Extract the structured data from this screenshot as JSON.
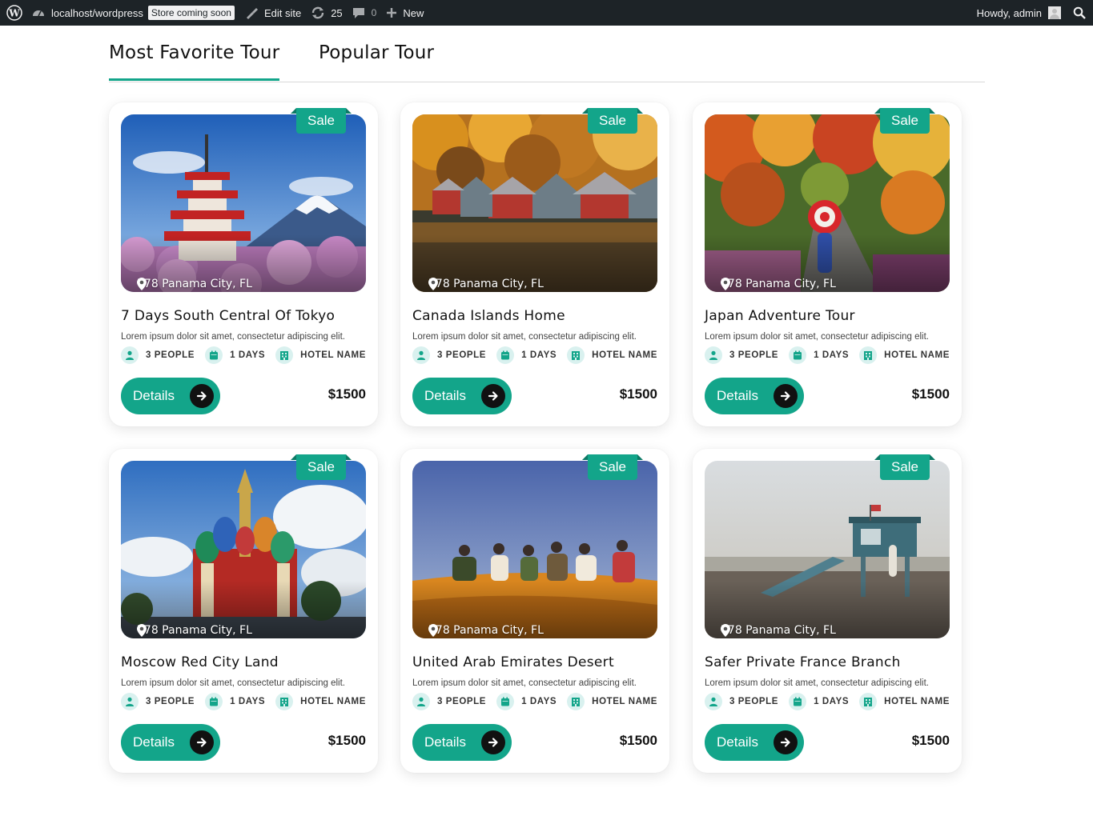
{
  "adminbar": {
    "site_name": "localhost/wordpress",
    "store_badge": "Store coming soon",
    "edit_site": "Edit site",
    "updates_count": "25",
    "comments_count": "0",
    "new_label": "New",
    "greeting": "Howdy, admin"
  },
  "tabs": [
    {
      "label": "Most Favorite Tour",
      "active": true
    },
    {
      "label": "Popular Tour",
      "active": false
    }
  ],
  "cards": [
    {
      "title": "7 Days South Central Of Tokyo",
      "sale": "Sale",
      "location": "778 Panama City, FL",
      "description": "Lorem ipsum dolor sit amet, consectetur adipiscing elit.",
      "people": "3 PEOPLE",
      "days": "1 DAYS",
      "hotel": "HOTEL NAME",
      "button": "Details",
      "price": "$1500",
      "image": "pagoda-mount-fuji"
    },
    {
      "title": "Canada Islands Home",
      "sale": "Sale",
      "location": "778 Panama City, FL",
      "description": "Lorem ipsum dolor sit amet, consectetur adipiscing elit.",
      "people": "3 PEOPLE",
      "days": "1 DAYS",
      "hotel": "HOTEL NAME",
      "button": "Details",
      "price": "$1500",
      "image": "lake-boathouses-autumn"
    },
    {
      "title": "Japan Adventure Tour",
      "sale": "Sale",
      "location": "778 Panama City, FL",
      "description": "Lorem ipsum dolor sit amet, consectetur adipiscing elit.",
      "people": "3 PEOPLE",
      "days": "1 DAYS",
      "hotel": "HOTEL NAME",
      "button": "Details",
      "price": "$1500",
      "image": "autumn-path-umbrella"
    },
    {
      "title": "Moscow Red City Land",
      "sale": "Sale",
      "location": "778 Panama City, FL",
      "description": "Lorem ipsum dolor sit amet, consectetur adipiscing elit.",
      "people": "3 PEOPLE",
      "days": "1 DAYS",
      "hotel": "HOTEL NAME",
      "button": "Details",
      "price": "$1500",
      "image": "cathedral-onion-domes"
    },
    {
      "title": "United Arab Emirates Desert",
      "sale": "Sale",
      "location": "778 Panama City, FL",
      "description": "Lorem ipsum dolor sit amet, consectetur adipiscing elit.",
      "people": "3 PEOPLE",
      "days": "1 DAYS",
      "hotel": "HOTEL NAME",
      "button": "Details",
      "price": "$1500",
      "image": "desert-dune-group"
    },
    {
      "title": "Safer Private France Branch",
      "sale": "Sale",
      "location": "778 Panama City, FL",
      "description": "Lorem ipsum dolor sit amet, consectetur adipiscing elit.",
      "people": "3 PEOPLE",
      "days": "1 DAYS",
      "hotel": "HOTEL NAME",
      "button": "Details",
      "price": "$1500",
      "image": "beach-lifeguard-tower"
    }
  ],
  "colors": {
    "accent": "#13a58a",
    "adminbar": "#1d2327",
    "icon_bg": "#d9f1ef"
  }
}
